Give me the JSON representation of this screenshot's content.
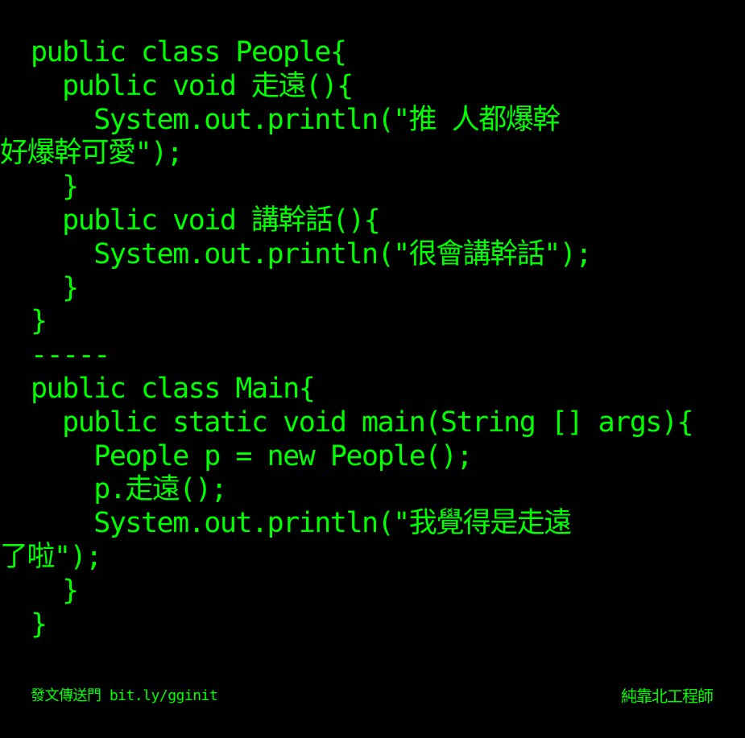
{
  "theme": {
    "background": "#000000",
    "text_color": "#00ff00"
  },
  "code": {
    "lines": [
      "public class People{",
      "  public void 走遠(){",
      "    System.out.println(\"推 人都爆幹",
      "好爆幹可愛\");",
      "  }",
      "  public void 講幹話(){",
      "    System.out.println(\"很會講幹話\");",
      "  }",
      "}",
      "-----",
      "public class Main{",
      "  public static void main(String [] args){",
      "    People p = new People();",
      "    p.走遠();",
      "    System.out.println(\"我覺得是走遠",
      "了啦\");",
      "  }",
      "}"
    ]
  },
  "footer": {
    "left_text": "發文傳送門 bit.ly/gginit",
    "right_text": "純靠北工程師"
  }
}
